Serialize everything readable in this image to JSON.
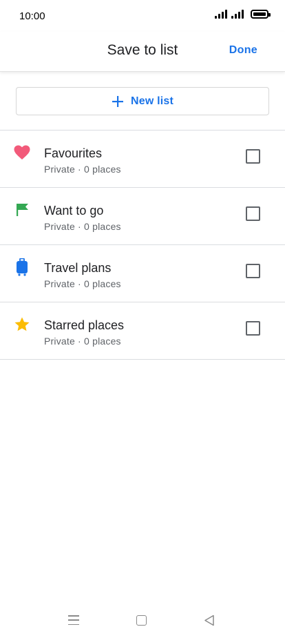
{
  "status_bar": {
    "time": "10:00"
  },
  "header": {
    "title": "Save to list",
    "done_label": "Done"
  },
  "new_list": {
    "label": "New list"
  },
  "colors": {
    "accent": "#1a73e8",
    "heart": "#f25a7a",
    "flag": "#34a853",
    "suitcase": "#1a73e8",
    "star": "#fbbc04"
  },
  "lists": [
    {
      "icon": "heart-icon",
      "title": "Favourites",
      "subtitle": "Private · 0 places",
      "checked": false
    },
    {
      "icon": "flag-icon",
      "title": "Want to go",
      "subtitle": "Private · 0 places",
      "checked": false
    },
    {
      "icon": "suitcase-icon",
      "title": "Travel plans",
      "subtitle": "Private · 0 places",
      "checked": false
    },
    {
      "icon": "star-icon",
      "title": "Starred places",
      "subtitle": "Private · 0 places",
      "checked": false
    }
  ]
}
